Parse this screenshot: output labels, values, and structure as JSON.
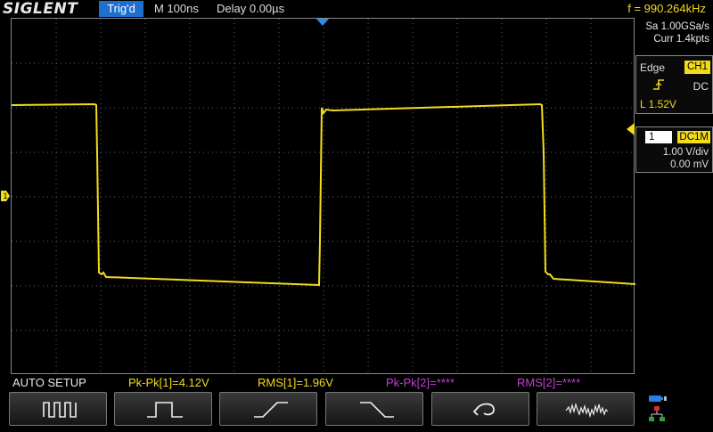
{
  "topbar": {
    "brand": "SIGLENT",
    "trigger_status": "Trig'd",
    "timebase": "M 100ns",
    "delay": "Delay 0.00µs",
    "frequency": "f = 990.264kHz"
  },
  "acquisition": {
    "sample_rate": "Sa 1.00GSa/s",
    "memory": "Curr 1.4kpts"
  },
  "trigger": {
    "type": "Edge",
    "source": "CH1",
    "coupling": "DC",
    "level": "L  1.52V",
    "slope_icon": "rising-edge-icon"
  },
  "channel": {
    "number": "1",
    "impedance": "DC1M",
    "volts_per_div": "1.00 V/div",
    "offset": "0.00 mV",
    "color": "#f2dc1a",
    "marker_label": "1"
  },
  "measurements": {
    "auto_setup": "AUTO SETUP",
    "items": [
      {
        "label": "Pk-Pk[1]=4.12V",
        "color": "#f2dc1a"
      },
      {
        "label": "RMS[1]=1.96V",
        "color": "#f2dc1a"
      },
      {
        "label": "Pk-Pk[2]=****",
        "color": "#c040d0"
      },
      {
        "label": "RMS[2]=****",
        "color": "#c040d0"
      }
    ]
  },
  "softkeys": [
    {
      "icon": "multi-cycle-icon"
    },
    {
      "icon": "single-cycle-icon"
    },
    {
      "icon": "rising-edge-icon"
    },
    {
      "icon": "falling-edge-icon"
    },
    {
      "icon": "undo-icon"
    },
    {
      "icon": "noise-waveform-icon"
    }
  ],
  "colors": {
    "trace": "#f2dc1a",
    "grid": "#666666",
    "trigger_badge": "#1f6fd0",
    "channel2_meas": "#c040d0"
  }
}
